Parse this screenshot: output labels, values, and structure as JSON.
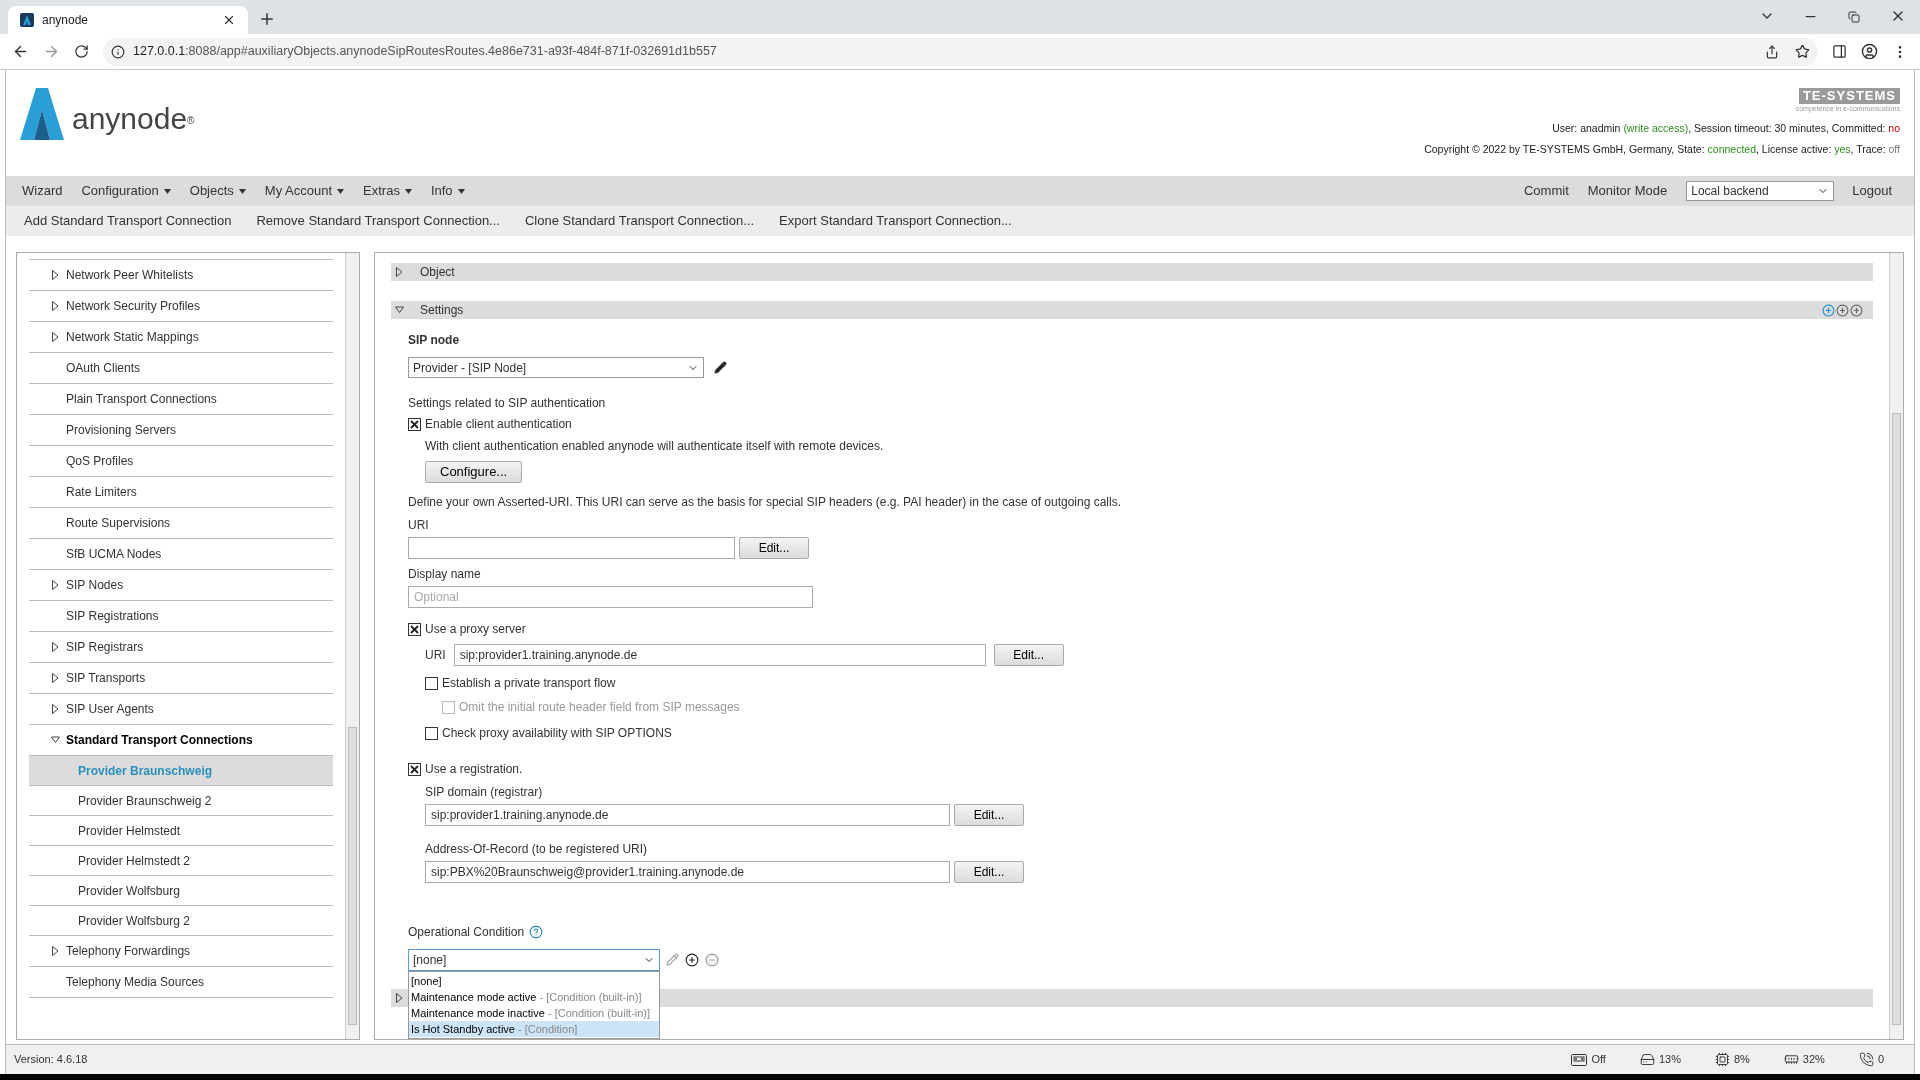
{
  "browser": {
    "tab_title": "anynode",
    "url_host": "127.0.0.1",
    "url_path": ":8088/app#auxiliaryObjects.anynodeSipRoutesRoutes.4e86e731-a93f-484f-871f-032691d1b557"
  },
  "header": {
    "logo_text": "anynode",
    "logo_mark": "®",
    "brand": "TE-SYSTEMS",
    "brand_tagline": "competence in e-communications",
    "status_lines": [
      [
        {
          "text": "User: anadmin ",
          "kind": "plain"
        },
        {
          "text": "(write access)",
          "kind": "good"
        },
        {
          "text": ", Session timeout: 30 minutes, Committed: ",
          "kind": "plain"
        },
        {
          "text": "no",
          "kind": "bad"
        }
      ],
      [
        {
          "text": "Copyright © 2022 by TE-SYSTEMS GmbH, Germany, State: ",
          "kind": "plain"
        },
        {
          "text": "connected",
          "kind": "good"
        },
        {
          "text": ", License active: ",
          "kind": "plain"
        },
        {
          "text": "yes",
          "kind": "good"
        },
        {
          "text": ", Trace: ",
          "kind": "plain"
        },
        {
          "text": "off",
          "kind": "muted"
        }
      ]
    ]
  },
  "menu": {
    "items": [
      {
        "label": "Wizard",
        "has_menu": false
      },
      {
        "label": "Configuration",
        "has_menu": true
      },
      {
        "label": "Objects",
        "has_menu": true
      },
      {
        "label": "My Account",
        "has_menu": true
      },
      {
        "label": "Extras",
        "has_menu": true
      },
      {
        "label": "Info",
        "has_menu": true
      }
    ],
    "right": [
      {
        "label": "Commit",
        "kind": "link"
      },
      {
        "label": "Monitor Mode",
        "kind": "link"
      },
      {
        "label": "Local backend",
        "kind": "select"
      },
      {
        "label": "Logout",
        "kind": "link"
      }
    ]
  },
  "actions": [
    "Add Standard Transport Connection",
    "Remove Standard Transport Connection...",
    "Clone Standard Transport Connection...",
    "Export Standard Transport Connection..."
  ],
  "sidebar": {
    "items": [
      {
        "label": "Network Peer Whitelists",
        "expandable": true,
        "expanded": false
      },
      {
        "label": "Network Security Profiles",
        "expandable": true,
        "expanded": false
      },
      {
        "label": "Network Static Mappings",
        "expandable": true,
        "expanded": false
      },
      {
        "label": "OAuth Clients",
        "expandable": false
      },
      {
        "label": "Plain Transport Connections",
        "expandable": false
      },
      {
        "label": "Provisioning Servers",
        "expandable": false
      },
      {
        "label": "QoS Profiles",
        "expandable": false
      },
      {
        "label": "Rate Limiters",
        "expandable": false
      },
      {
        "label": "Route Supervisions",
        "expandable": false
      },
      {
        "label": "SfB UCMA Nodes",
        "expandable": false
      },
      {
        "label": "SIP Nodes",
        "expandable": true,
        "expanded": false
      },
      {
        "label": "SIP Registrations",
        "expandable": false
      },
      {
        "label": "SIP Registrars",
        "expandable": true,
        "expanded": false
      },
      {
        "label": "SIP Transports",
        "expandable": true,
        "expanded": false
      },
      {
        "label": "SIP User Agents",
        "expandable": true,
        "expanded": false
      },
      {
        "label": "Standard Transport Connections",
        "expandable": true,
        "expanded": true,
        "children": [
          {
            "label": "Provider Braunschweig",
            "selected": true
          },
          {
            "label": "Provider Braunschweig 2",
            "selected": false
          },
          {
            "label": "Provider Helmstedt",
            "selected": false
          },
          {
            "label": "Provider Helmstedt 2",
            "selected": false
          },
          {
            "label": "Provider Wolfsburg",
            "selected": false
          },
          {
            "label": "Provider Wolfsburg 2",
            "selected": false
          }
        ]
      },
      {
        "label": "Telephony Forwardings",
        "expandable": true,
        "expanded": false
      },
      {
        "label": "Telephony Media Sources",
        "expandable": false
      }
    ]
  },
  "sections": [
    {
      "title": "Object",
      "expanded": false
    },
    {
      "title": "Settings",
      "expanded": true
    }
  ],
  "settings": {
    "sip_node": {
      "label": "SIP node",
      "value": "Provider - [SIP Node]"
    },
    "auth_heading": "Settings related to SIP authentication",
    "client_auth": {
      "label": "Enable client authentication",
      "checked": true,
      "description": "With client authentication enabled anynode will authenticate itself with remote devices.",
      "button": "Configure..."
    },
    "asserted_description": "Define your own Asserted-URI. This URI can serve as the basis for special SIP headers (e.g. PAI header) in the case of outgoing calls.",
    "asserted_uri": {
      "label": "URI",
      "button": "Edit..."
    },
    "display_name": {
      "label": "Display name",
      "placeholder": "Optional"
    },
    "proxy": {
      "label": "Use a proxy server",
      "checked": true,
      "uri_label": "URI",
      "uri_value": "sip:provider1.training.anynode.de",
      "button": "Edit...",
      "options": [
        {
          "label": "Establish a private transport flow",
          "checked": false,
          "disabled": false,
          "children": [
            {
              "label": "Omit the initial route header field from SIP messages",
              "checked": false,
              "disabled": true
            }
          ]
        },
        {
          "label": "Check proxy availability with SIP OPTIONS",
          "checked": false,
          "disabled": false
        }
      ]
    },
    "registration": {
      "label": "Use a registration.",
      "checked": true,
      "fields": [
        {
          "label": "SIP domain (registrar)",
          "value": "sip:provider1.training.anynode.de",
          "button": "Edit..."
        },
        {
          "label": "Address-Of-Record (to be registered URI)",
          "value": "sip:PBX%20Braunschweig@provider1.training.anynode.de",
          "button": "Edit..."
        }
      ]
    },
    "condition": {
      "label": "Operational Condition",
      "value": "[none]",
      "expanded": true,
      "options": [
        {
          "name": "[none]",
          "highlighted": false
        },
        {
          "name": "Maintenance mode active",
          "type": " - [Condition (built-in)]",
          "highlighted": false
        },
        {
          "name": "Maintenance mode inactive",
          "type": " - [Condition (built-in)]",
          "highlighted": false
        },
        {
          "name": "Is Hot Standby active",
          "type": " - [Condition]",
          "highlighted": true
        }
      ]
    }
  },
  "status_bar": {
    "version": "Version: 4.6.18",
    "indicators": [
      {
        "kind": "tape",
        "text": "Off"
      },
      {
        "kind": "disk",
        "text": "13%"
      },
      {
        "kind": "cpu",
        "text": "8%"
      },
      {
        "kind": "memory",
        "text": "32%"
      },
      {
        "kind": "calls",
        "text": "0"
      }
    ]
  }
}
